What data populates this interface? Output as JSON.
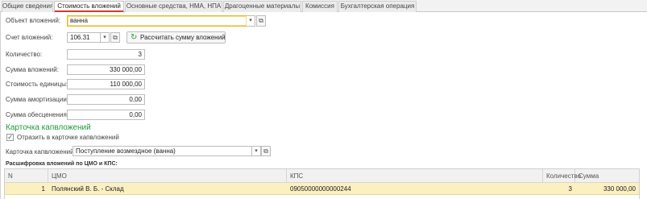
{
  "tabs": [
    {
      "label": "Общие сведения"
    },
    {
      "label": "Стоимость вложений"
    },
    {
      "label": "Основные средства, НМА, НПА"
    },
    {
      "label": "Драгоценные материалы"
    },
    {
      "label": "Комиссия"
    },
    {
      "label": "Бухгалтерская операция"
    }
  ],
  "active_tab_index": 1,
  "form": {
    "object": {
      "label": "Объект вложений:",
      "value": "ванна"
    },
    "account": {
      "label": "Счет вложений:",
      "value": "106.31",
      "calc_button": "Рассчитать сумму вложений"
    },
    "quantity": {
      "label": "Количество:",
      "value": "3"
    },
    "sum": {
      "label": "Сумма вложений:",
      "value": "330 000,00"
    },
    "unit_cost": {
      "label": "Стоимость единицы:",
      "value": "110 000,00"
    },
    "amortization": {
      "label": "Сумма амортизации:",
      "value": "0,00"
    },
    "impairment": {
      "label": "Сумма обесценения:",
      "value": "0,00"
    }
  },
  "card": {
    "section_title": "Карточка капвложений",
    "checkbox_label": "Отразить в карточке капвложений",
    "checkbox_checked": true,
    "card_label": "Карточка капвложений:",
    "card_value": "Поступление возмездное (ванна)"
  },
  "breakdown": {
    "title": "Расшифровка вложений по ЦМО и КПС:",
    "columns": [
      "N",
      "ЦМО",
      "КПС",
      "Количество",
      "Сумма"
    ],
    "rows": [
      {
        "n": "1",
        "cmo": "Полянский В. Б. - Склад",
        "kps": "09050000000000244",
        "qty": "3",
        "sum": "330 000,00"
      }
    ]
  },
  "colors": {
    "accent_active_tab": "#d13a2e",
    "section_green": "#1e9a3c",
    "selected_row": "#fbf0c0",
    "focus_border": "#e8b62a"
  }
}
